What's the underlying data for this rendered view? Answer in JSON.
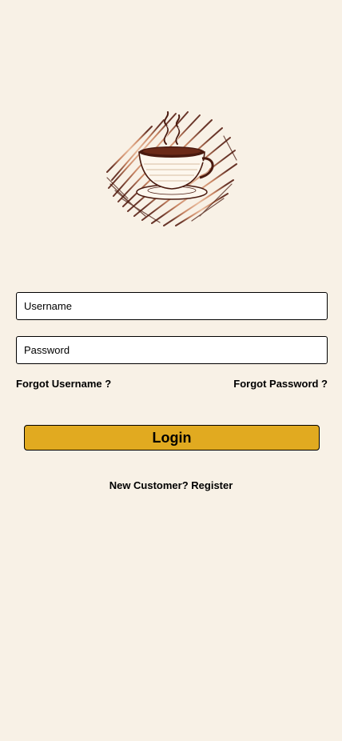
{
  "logo": {
    "icon": "coffee-cup-icon",
    "colors": {
      "brush": "#c9845c",
      "dark": "#4a1a0f",
      "cup": "#fdf7ee"
    }
  },
  "form": {
    "username_placeholder": "Username",
    "password_placeholder": "Password",
    "forgot_username": "Forgot Username ?",
    "forgot_password": "Forgot Password ?",
    "login_label": "Login",
    "register_label": "New Customer? Register"
  },
  "theme": {
    "background": "#f8f1e6",
    "accent": "#e1aa20"
  }
}
